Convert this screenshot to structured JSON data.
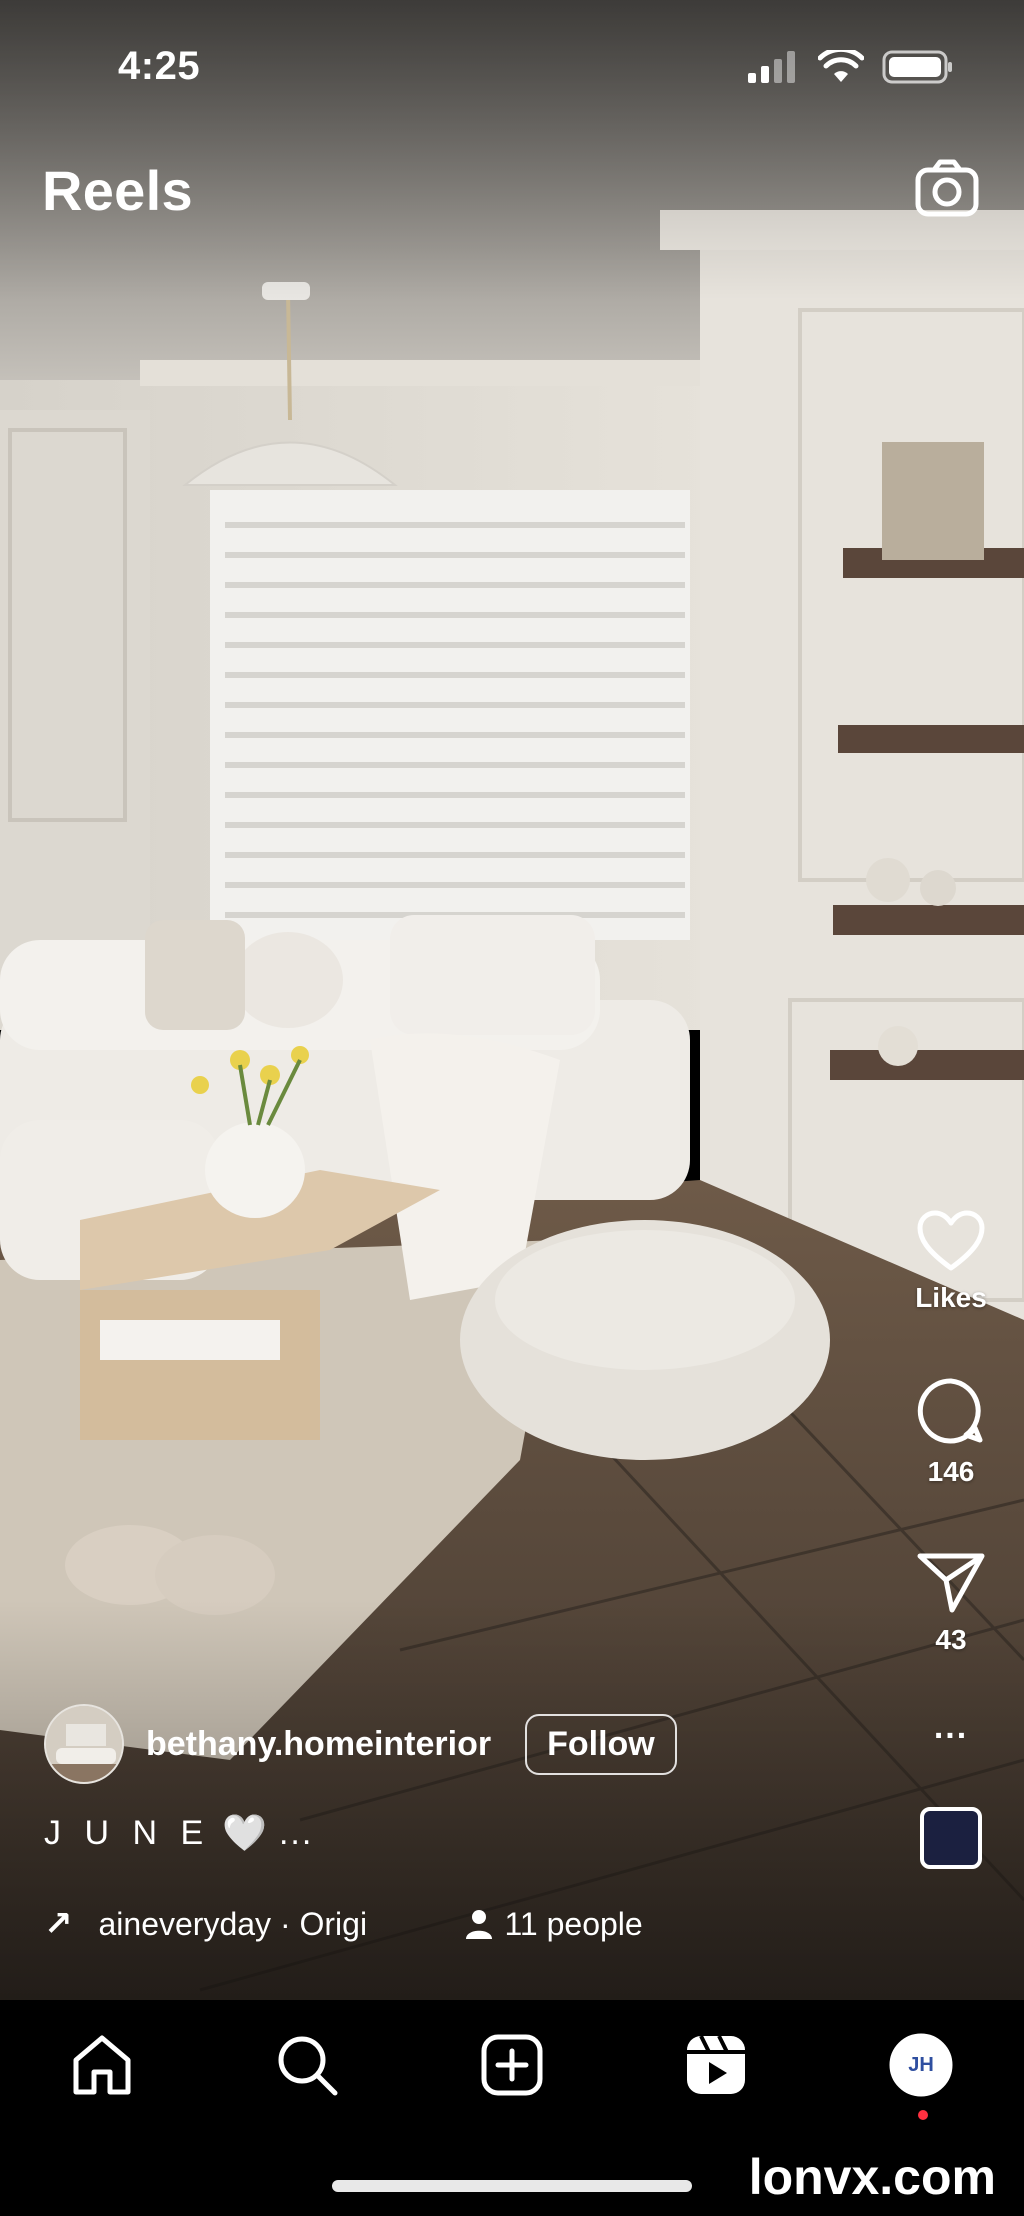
{
  "status_bar": {
    "time": "4:25"
  },
  "header": {
    "title": "Reels"
  },
  "actions": {
    "likes_label": "Likes",
    "comments_count": "146",
    "shares_count": "43",
    "more_label": "..."
  },
  "post": {
    "username": "bethany.homeinterior",
    "follow_label": "Follow",
    "caption": "J U N E",
    "caption_heart": "🤍",
    "caption_more": "...",
    "audio_text": "aineveryday · Origi",
    "people_text": "11 people"
  },
  "tabs": [
    "home-tab",
    "search-tab",
    "create-tab",
    "reels-tab",
    "profile-tab"
  ],
  "watermark": "lonvx.com",
  "icons": [
    "camera-icon",
    "heart-icon",
    "comment-icon",
    "share-icon",
    "more-icon",
    "arrow-icon",
    "person-icon",
    "home-icon",
    "search-icon",
    "plus-square-icon",
    "reels-icon"
  ],
  "colors": {
    "accent_dot": "#ff3040",
    "background": "#000000"
  }
}
